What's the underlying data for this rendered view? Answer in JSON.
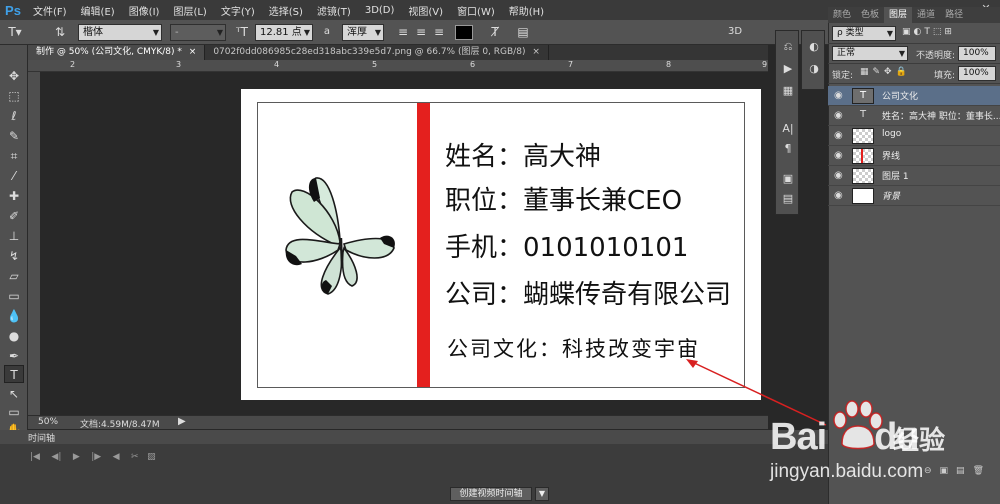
{
  "app": {
    "logo": "Ps"
  },
  "menu": [
    "文件(F)",
    "编辑(E)",
    "图像(I)",
    "图层(L)",
    "文字(Y)",
    "选择(S)",
    "滤镜(T)",
    "3D(D)",
    "视图(V)",
    "窗口(W)",
    "帮助(H)"
  ],
  "options": {
    "font_family": "楷体",
    "font_style": "-",
    "font_size": "12.81 点",
    "aa_label": "a",
    "antialias": "浑厚",
    "mode_3d": "3D"
  },
  "tabs": [
    {
      "label": "制作 @ 50% (公司文化, CMYK/8) *",
      "close": "×"
    },
    {
      "label": "0702f0dd086985c28ed318abc339e5d7.png @ 66.7% (图层 0, RGB/8)",
      "close": "×"
    }
  ],
  "ruler_marks": [
    "2",
    "3",
    "4",
    "5",
    "6",
    "7",
    "8",
    "9"
  ],
  "card": {
    "name": "姓名：高大神",
    "title": "职位：董事长兼CEO",
    "phone": "手机：0101010101",
    "company": "公司：蝴蝶传奇有限公司",
    "culture": "公司文化：科技改变宇宙"
  },
  "status": {
    "zoom": "50%",
    "doc": "文档:4.59M/8.47M"
  },
  "timeline": {
    "title": "时间轴",
    "create_button": "创建视频时间轴"
  },
  "layers_panel": {
    "tabs": [
      "颜色",
      "色板",
      "图层",
      "通道",
      "路径"
    ],
    "active_tab": "图层",
    "kind_label": "ρ 类型",
    "blend_mode": "正常",
    "opacity_label": "不透明度:",
    "opacity": "100%",
    "lock_label": "锁定:",
    "fill_label": "填充:",
    "fill": "100%",
    "layers": [
      {
        "name": "公司文化",
        "type": "text"
      },
      {
        "name": "姓名：高大神 职位：董事长...",
        "type": "text"
      },
      {
        "name": "logo",
        "type": "image"
      },
      {
        "name": "界线",
        "type": "image"
      },
      {
        "name": "图层 1",
        "type": "image"
      },
      {
        "name": "背景",
        "type": "background"
      }
    ]
  },
  "watermark": {
    "brand": "Bai",
    "brand2": "du",
    "cn": "经验",
    "url": "jingyan.baidu.com"
  },
  "colors": {
    "accent_red": "#e4201e",
    "selection": "#5b6f89"
  }
}
